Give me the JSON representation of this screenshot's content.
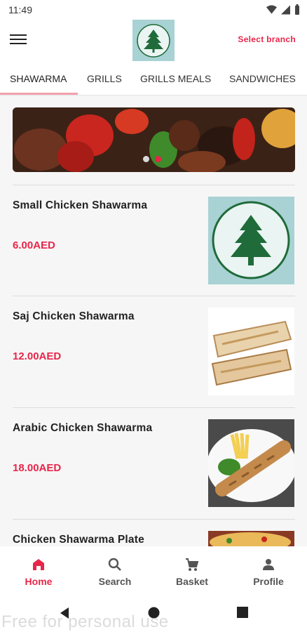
{
  "status_bar": {
    "time": "11:49"
  },
  "header": {
    "select_branch_label": "Select branch"
  },
  "tabs": [
    {
      "label": "SHAWARMA",
      "active": true
    },
    {
      "label": "GRILLS",
      "active": false
    },
    {
      "label": "GRILLS MEALS",
      "active": false
    },
    {
      "label": "SANDWICHES",
      "active": false
    }
  ],
  "banner": {
    "dots": 2,
    "active_dot": 1
  },
  "menu_items": [
    {
      "name": "Small Chicken Shawarma",
      "price": "6.00AED"
    },
    {
      "name": "Saj Chicken Shawarma",
      "price": "12.00AED"
    },
    {
      "name": "Arabic Chicken Shawarma",
      "price": "18.00AED"
    },
    {
      "name": "Chicken Shawarma Plate",
      "price": ""
    }
  ],
  "bottom_nav": [
    {
      "label": "Home",
      "icon": "home-icon",
      "active": true
    },
    {
      "label": "Search",
      "icon": "search-icon",
      "active": false
    },
    {
      "label": "Basket",
      "icon": "cart-icon",
      "active": false
    },
    {
      "label": "Profile",
      "icon": "person-icon",
      "active": false
    }
  ],
  "watermark": "Free for personal use",
  "colors": {
    "accent": "#e8264a",
    "logo_bg": "#a9d2d4",
    "logo_green": "#1f6b3a"
  }
}
